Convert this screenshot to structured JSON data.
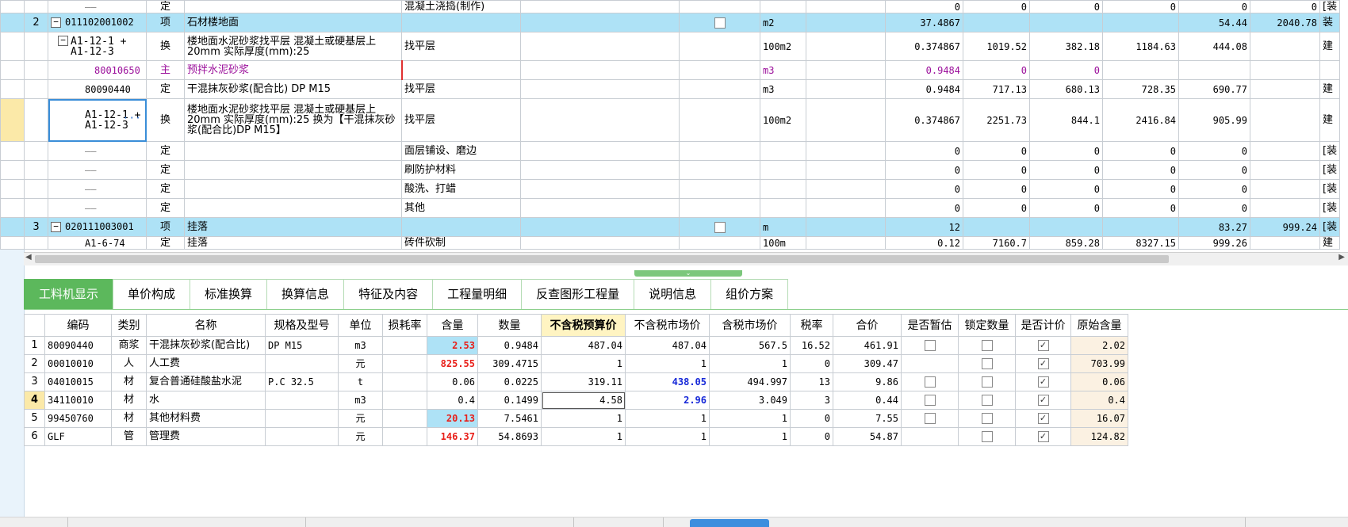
{
  "top_grid": {
    "rows": [
      {
        "type": "partial",
        "no": "",
        "code": "",
        "cat": "定",
        "name": "",
        "feature": "混凝土浇捣(制作)",
        "chk": false,
        "unit": "",
        "qty": "0",
        "c1": "0",
        "c2": "0",
        "c3": "0",
        "c4": "0",
        "c5": "0",
        "last": "[装"
      },
      {
        "type": "item",
        "no": "2",
        "code": "011102001002",
        "cat": "项",
        "name": "石材楼地面",
        "feature": "",
        "chk": true,
        "unit": "m2",
        "qty": "37.4867",
        "c1": "",
        "c2": "",
        "c3": "",
        "c4": "54.44",
        "c5": "2040.78",
        "last": "装"
      },
      {
        "type": "tall",
        "no": "",
        "code": "A1-12-1 + A1-12-3",
        "cat": "换",
        "name": "楼地面水泥砂浆找平层 混凝土或硬基层上 20mm  实际厚度(mm):25",
        "feature": "找平层",
        "chk": false,
        "unit": "100m2",
        "qty": "0.374867",
        "c1": "1019.52",
        "c2": "382.18",
        "c3": "1184.63",
        "c4": "444.08",
        "c5": "",
        "last": "建"
      },
      {
        "type": "purple",
        "no": "",
        "code": "80010650",
        "cat": "主",
        "name": "预拌水泥砂浆",
        "feature": "",
        "chk": false,
        "unit": "m3",
        "qty": "0.9484",
        "c1": "0",
        "c2": "0",
        "c3": "",
        "c4": "",
        "c5": "",
        "last": ""
      },
      {
        "type": "normal",
        "no": "",
        "code": "80090440",
        "cat": "定",
        "name": "干混抹灰砂浆(配合比) DP M15",
        "feature": "找平层",
        "chk": false,
        "unit": "m3",
        "qty": "0.9484",
        "c1": "717.13",
        "c2": "680.13",
        "c3": "728.35",
        "c4": "690.77",
        "c5": "",
        "last": "建"
      },
      {
        "type": "tall3",
        "no": "",
        "code": "A1-12-1 + A1-12-3",
        "cat": "换",
        "name": "楼地面水泥砂浆找平层 混凝土或硬基层上 20mm  实际厚度(mm):25  换为【干混抹灰砂浆(配合比)DP M15】",
        "feature": "找平层",
        "chk": false,
        "unit": "100m2",
        "qty": "0.374867",
        "c1": "2251.73",
        "c2": "844.1",
        "c3": "2416.84",
        "c4": "905.99",
        "c5": "",
        "last": "建"
      },
      {
        "type": "normal",
        "no": "",
        "code": "",
        "cat": "定",
        "name": "",
        "feature": "面层铺设、磨边",
        "chk": false,
        "unit": "",
        "qty": "0",
        "c1": "0",
        "c2": "0",
        "c3": "0",
        "c4": "0",
        "c5": "",
        "last": "[装"
      },
      {
        "type": "normal",
        "no": "",
        "code": "",
        "cat": "定",
        "name": "",
        "feature": "刷防护材料",
        "chk": false,
        "unit": "",
        "qty": "0",
        "c1": "0",
        "c2": "0",
        "c3": "0",
        "c4": "0",
        "c5": "",
        "last": "[装"
      },
      {
        "type": "normal",
        "no": "",
        "code": "",
        "cat": "定",
        "name": "",
        "feature": "酸洗、打蜡",
        "chk": false,
        "unit": "",
        "qty": "0",
        "c1": "0",
        "c2": "0",
        "c3": "0",
        "c4": "0",
        "c5": "",
        "last": "[装"
      },
      {
        "type": "normal",
        "no": "",
        "code": "",
        "cat": "定",
        "name": "",
        "feature": "其他",
        "chk": false,
        "unit": "",
        "qty": "0",
        "c1": "0",
        "c2": "0",
        "c3": "0",
        "c4": "0",
        "c5": "",
        "last": "[装"
      },
      {
        "type": "item",
        "no": "3",
        "code": "020111003001",
        "cat": "项",
        "name": "挂落",
        "feature": "",
        "chk": true,
        "unit": "m",
        "qty": "12",
        "c1": "",
        "c2": "",
        "c3": "",
        "c4": "83.27",
        "c5": "999.24",
        "last": "[装"
      },
      {
        "type": "partial2",
        "no": "",
        "code": "A1-6-74",
        "cat": "定",
        "name": "挂落",
        "feature": "砖件砍制",
        "chk": false,
        "unit": "100m",
        "qty": "0.12",
        "c1": "7160.7",
        "c2": "859.28",
        "c3": "8327.15",
        "c4": "999.26",
        "c5": "",
        "last": "建"
      }
    ],
    "more_icon": "···"
  },
  "tabs": [
    {
      "label": "工料机显示",
      "active": true
    },
    {
      "label": "单价构成",
      "active": false
    },
    {
      "label": "标准换算",
      "active": false
    },
    {
      "label": "换算信息",
      "active": false
    },
    {
      "label": "特征及内容",
      "active": false
    },
    {
      "label": "工程量明细",
      "active": false
    },
    {
      "label": "反查图形工程量",
      "active": false
    },
    {
      "label": "说明信息",
      "active": false
    },
    {
      "label": "组价方案",
      "active": false
    }
  ],
  "bottom_grid": {
    "headers": [
      "",
      "编码",
      "类别",
      "名称",
      "规格及型号",
      "单位",
      "损耗率",
      "含量",
      "数量",
      "不含税预算价",
      "不含税市场价",
      "含税市场价",
      "税率",
      "合价",
      "是否暂估",
      "锁定数量",
      "是否计价",
      "原始含量"
    ],
    "rows": [
      {
        "no": "1",
        "code": "80090440",
        "cat": "商浆",
        "name": "干混抹灰砂浆(配合比)",
        "spec": "DP M15",
        "unit": "m3",
        "loss": "",
        "content": "2.53",
        "content_style": "red-blue",
        "qty": "0.9484",
        "budget": "487.04",
        "market": "487.04",
        "market_style": "",
        "tax_market": "567.5",
        "tax": "16.52",
        "total": "461.91",
        "tempest": false,
        "lock": false,
        "priced": true,
        "orig": "2.02"
      },
      {
        "no": "2",
        "code": "00010010",
        "cat": "人",
        "name": "人工费",
        "spec": "",
        "unit": "元",
        "loss": "",
        "content": "825.55",
        "content_style": "red",
        "qty": "309.4715",
        "budget": "1",
        "market": "1",
        "market_style": "",
        "tax_market": "1",
        "tax": "0",
        "total": "309.47",
        "tempest": null,
        "lock": false,
        "priced": true,
        "orig": "703.99"
      },
      {
        "no": "3",
        "code": "04010015",
        "cat": "材",
        "name": "复合普通硅酸盐水泥",
        "spec": "P.C 32.5",
        "unit": "t",
        "loss": "",
        "content": "0.06",
        "content_style": "",
        "qty": "0.0225",
        "budget": "319.11",
        "market": "438.05",
        "market_style": "blue",
        "tax_market": "494.997",
        "tax": "13",
        "total": "9.86",
        "tempest": false,
        "lock": false,
        "priced": true,
        "orig": "0.06"
      },
      {
        "no": "4",
        "code": "34110010",
        "cat": "材",
        "name": "水",
        "spec": "",
        "unit": "m3",
        "loss": "",
        "content": "0.4",
        "content_style": "",
        "qty": "0.1499",
        "budget": "4.58",
        "market": "2.96",
        "market_style": "blue",
        "tax_market": "3.049",
        "tax": "3",
        "total": "0.44",
        "tempest": false,
        "lock": false,
        "priced": true,
        "orig": "0.4"
      },
      {
        "no": "5",
        "code": "99450760",
        "cat": "材",
        "name": "其他材料费",
        "spec": "",
        "unit": "元",
        "loss": "",
        "content": "20.13",
        "content_style": "red-blue",
        "qty": "7.5461",
        "budget": "1",
        "market": "1",
        "market_style": "",
        "tax_market": "1",
        "tax": "0",
        "total": "7.55",
        "tempest": false,
        "lock": false,
        "priced": true,
        "orig": "16.07"
      },
      {
        "no": "6",
        "code": "GLF",
        "cat": "管",
        "name": "管理费",
        "spec": "",
        "unit": "元",
        "loss": "",
        "content": "146.37",
        "content_style": "red",
        "qty": "54.8693",
        "budget": "1",
        "market": "1",
        "market_style": "",
        "tax_market": "1",
        "tax": "0",
        "total": "54.87",
        "tempest": null,
        "lock": false,
        "priced": true,
        "orig": "124.82"
      }
    ]
  },
  "colors": {
    "highlight_row": "#aee2f6",
    "tab_active": "#5cb85c",
    "selected_header": "#fff4c2",
    "red": "#e8201a",
    "blue": "#1628d8"
  }
}
